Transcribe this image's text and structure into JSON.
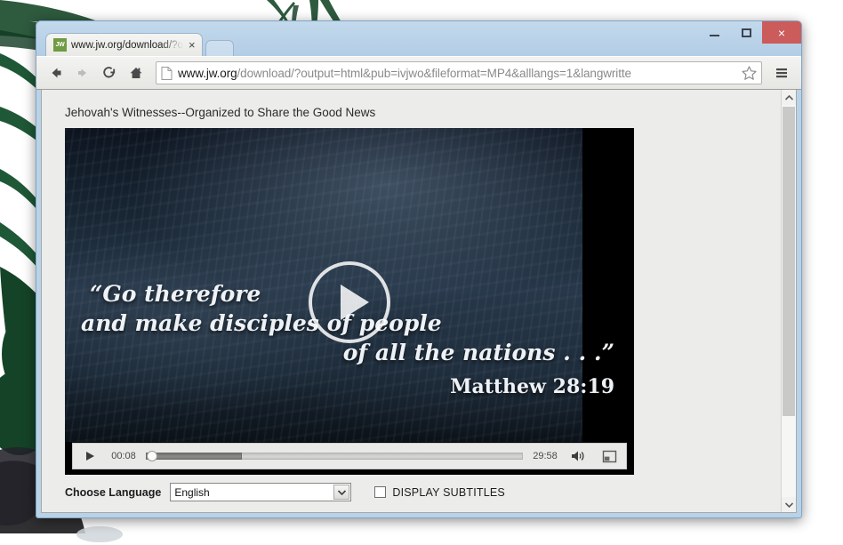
{
  "window": {
    "minimize_label": "Minimize",
    "maximize_label": "Maximize",
    "close_label": "×"
  },
  "browser": {
    "tab": {
      "favicon_text": "JW",
      "title": "www.jw.org/download/?o",
      "close_label": "×"
    },
    "new_tab_label": "",
    "toolbar": {
      "back_label": "←",
      "forward_label": "→",
      "reload_label": "↻",
      "home_label": "⌂",
      "menu_label": "☰"
    },
    "omnibox": {
      "host": "www.jw.org",
      "path": "/download/?output=html&pub=ivjwo&fileformat=MP4&alllangs=1&langwritte",
      "full_url": "www.jw.org/download/?output=html&pub=ivjwo&fileformat=MP4&alllangs=1&langwritte",
      "bookmark_label": "☆"
    }
  },
  "page": {
    "heading": "Jehovah's Witnesses--Organized to Share the Good News",
    "video": {
      "quote_line1": "“Go therefore",
      "quote_line2": "and make disciples of people",
      "quote_line3": "of all the nations . . .”",
      "citation": "Matthew 28:19",
      "play_overlay_label": "Play"
    },
    "controls": {
      "play_label": "Play",
      "current_time": "00:08",
      "duration": "29:58",
      "progress_percent": 25.5,
      "playhead_percent": 0.8,
      "volume_label": "Volume",
      "fullscreen_label": "Full screen"
    },
    "options": {
      "language_label": "Choose Language",
      "language_value": "English",
      "language_options": [
        "English"
      ],
      "subtitles_label": "DISPLAY SUBTITLES",
      "subtitles_checked": false
    }
  },
  "scrollbar": {
    "up_label": "⌃",
    "down_label": "⌄"
  },
  "colors": {
    "close_button": "#cc5b5b",
    "favicon": "#6f9b44",
    "window_frame": "#b9d2e8",
    "toolbar": "#ecece9"
  }
}
